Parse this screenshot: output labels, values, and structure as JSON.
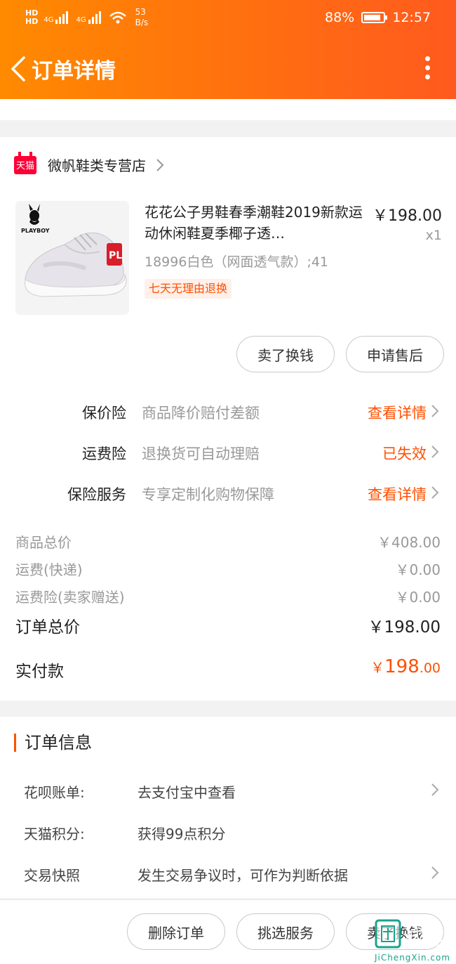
{
  "status_bar": {
    "hd1": "HD",
    "hd2": "HD",
    "net1": "4G",
    "net2": "4G",
    "speed_value": "53",
    "speed_unit": "B/s",
    "battery": "88%",
    "battery_level": 0.88,
    "time": "12:57"
  },
  "header": {
    "title": "订单详情"
  },
  "shop": {
    "badge": "天猫",
    "name": "微帆鞋类专营店"
  },
  "product": {
    "brand_logo": "PLAYBOY",
    "name": "花花公子男鞋春季潮鞋2019新款运动休闲鞋夏季椰子透…",
    "price": "￥198.00",
    "qty": "x1",
    "sku": "18996白色（网面透气款）;41",
    "tag": "七天无理由退换",
    "actions": [
      "卖了换钱",
      "申请售后"
    ]
  },
  "insurance": [
    {
      "label": "保价险",
      "desc": "商品降价赔付差额",
      "link": "查看详情"
    },
    {
      "label": "运费险",
      "desc": "退换货可自动理赔",
      "link": "已失效"
    },
    {
      "label": "保险服务",
      "desc": "专享定制化购物保障",
      "link": "查看详情"
    }
  ],
  "fees": [
    {
      "label": "商品总价",
      "value": "￥408.00"
    },
    {
      "label": "运费(快递)",
      "value": "￥0.00"
    },
    {
      "label": "运费险(卖家赠送)",
      "value": "￥0.00"
    }
  ],
  "order_total": {
    "label": "订单总价",
    "value": "￥198.00"
  },
  "paid": {
    "label": "实付款",
    "currency": "￥",
    "integer": "198",
    "decimal": ".00"
  },
  "order_info": {
    "title": "订单信息",
    "rows": [
      {
        "label": "花呗账单:",
        "value": "去支付宝中查看"
      },
      {
        "label": "天猫积分:",
        "value": "获得99点积分"
      },
      {
        "label": "交易快照",
        "value": "发生交易争议时，可作为判断依据"
      }
    ]
  },
  "bottom_actions": [
    "删除订单",
    "挑选服务",
    "卖了换钱"
  ],
  "watermark": {
    "text": "诚信",
    "sub": "JiChengXin.com"
  },
  "colors": {
    "accent": "#ff5000",
    "header_start": "#ff8a00",
    "header_end": "#ff5a1e",
    "tmall_red": "#ff0036"
  }
}
